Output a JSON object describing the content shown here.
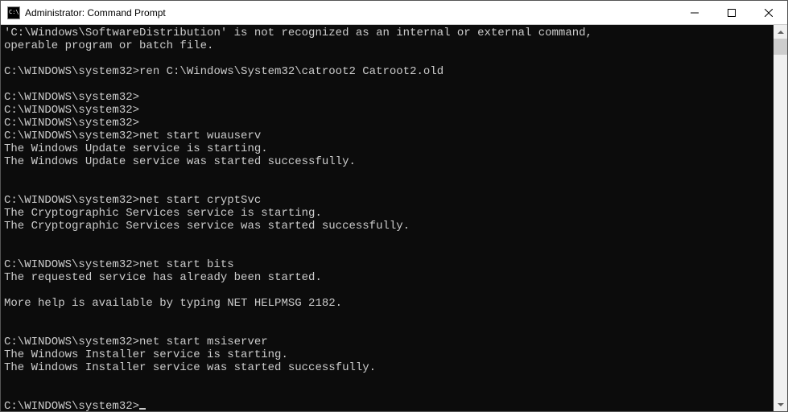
{
  "window": {
    "title": "Administrator: Command Prompt"
  },
  "terminal": {
    "lines": [
      "'C:\\Windows\\SoftwareDistribution' is not recognized as an internal or external command,",
      "operable program or batch file.",
      "",
      "C:\\WINDOWS\\system32>ren C:\\Windows\\System32\\catroot2 Catroot2.old",
      "",
      "C:\\WINDOWS\\system32>",
      "C:\\WINDOWS\\system32>",
      "C:\\WINDOWS\\system32>",
      "C:\\WINDOWS\\system32>net start wuauserv",
      "The Windows Update service is starting.",
      "The Windows Update service was started successfully.",
      "",
      "",
      "C:\\WINDOWS\\system32>net start cryptSvc",
      "The Cryptographic Services service is starting.",
      "The Cryptographic Services service was started successfully.",
      "",
      "",
      "C:\\WINDOWS\\system32>net start bits",
      "The requested service has already been started.",
      "",
      "More help is available by typing NET HELPMSG 2182.",
      "",
      "",
      "C:\\WINDOWS\\system32>net start msiserver",
      "The Windows Installer service is starting.",
      "The Windows Installer service was started successfully.",
      "",
      "",
      "C:\\WINDOWS\\system32>"
    ],
    "cursor_after_last": true
  }
}
